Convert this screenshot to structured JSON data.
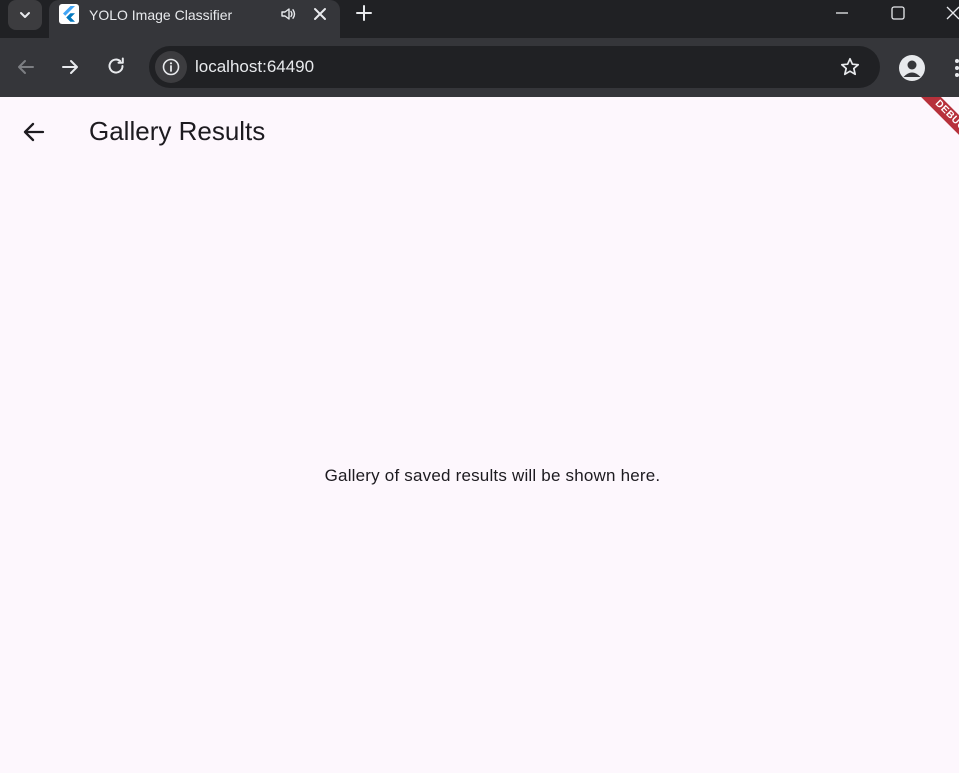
{
  "browser": {
    "tab": {
      "title": "YOLO Image Classifier"
    },
    "address_bar": {
      "url": "localhost:64490"
    },
    "colors": {
      "frame": "#202124",
      "toolbar": "#35363a",
      "text": "#e8eaed"
    }
  },
  "app": {
    "appbar": {
      "title": "Gallery Results"
    },
    "body": {
      "message": "Gallery of saved results will be shown here."
    },
    "debug_banner": "DEBUG",
    "colors": {
      "background": "#fdf7fd",
      "text": "#1d1b20",
      "debug_banner": "#b7313b"
    }
  }
}
